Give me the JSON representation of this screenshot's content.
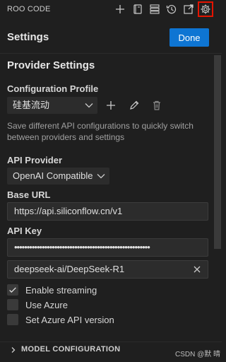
{
  "header": {
    "app_title": "ROO CODE",
    "icons": [
      "plus-icon",
      "notebook-icon",
      "stack-icon",
      "history-icon",
      "popout-icon",
      "gear-icon"
    ]
  },
  "settings": {
    "title": "Settings",
    "done_label": "Done"
  },
  "provider_settings": {
    "section_title": "Provider Settings",
    "config_profile_label": "Configuration Profile",
    "config_profile_value": "硅基流动",
    "help_text": "Save different API configurations to quickly switch between providers and settings",
    "api_provider_label": "API Provider",
    "api_provider_value": "OpenAI Compatible",
    "base_url_label": "Base URL",
    "base_url_value": "https://api.siliconflow.cn/v1",
    "api_key_label": "API Key",
    "api_key_value": "••••••••••••••••••••••••••••••••••••••••••••••••••••••",
    "model_value": "deepseek-ai/DeepSeek-R1"
  },
  "options": [
    {
      "label": "Enable streaming",
      "checked": true
    },
    {
      "label": "Use Azure",
      "checked": false
    },
    {
      "label": "Set Azure API version",
      "checked": false
    }
  ],
  "footer": {
    "model_config_label": "MODEL CONFIGURATION",
    "watermark": "CSDN @默 晴"
  },
  "colors": {
    "accent": "#0e75d3",
    "active_outline": "#e51400",
    "background": "#1f1f1f"
  }
}
